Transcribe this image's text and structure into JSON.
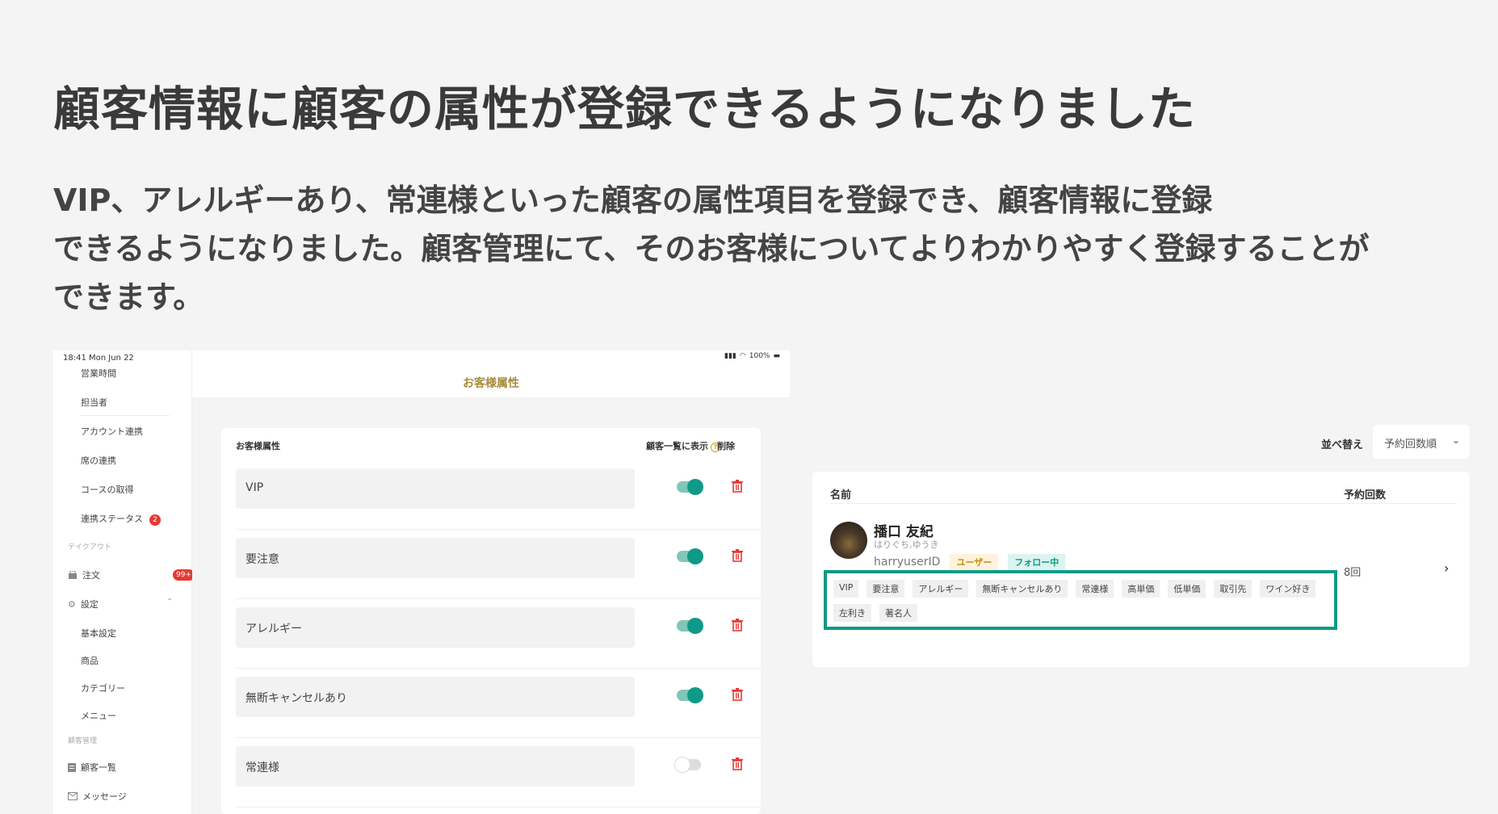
{
  "headline": "顧客情報に顧客の属性が登録できるようになりました",
  "description": [
    "VIP、アレルギーあり、常連様といった顧客の属性項目を登録でき、顧客情報に登録",
    "できるようになりました。顧客管理にて、そのお客様についてよりわかりやすく登録することが",
    "できます。"
  ],
  "ipad": {
    "status_time": "18:41 Mon Jun 22",
    "status_battery": "100%",
    "sidebar": {
      "items_top": [
        "営業時間",
        "担当者",
        "アカウント連携",
        "席の連携",
        "コースの取得"
      ],
      "link_status": "連携ステータス",
      "link_status_badge": "2",
      "section_takeout": "テイクアウト",
      "orders": "注文",
      "orders_badge": "99+",
      "settings": "設定",
      "settings_children": [
        "基本設定",
        "商品",
        "カテゴリー",
        "メニュー"
      ],
      "section_customers": "顧客管理",
      "customer_list": "顧客一覧",
      "messages": "メッセージ"
    },
    "page_title": "お客様属性",
    "table_headers": {
      "attribute": "お客様属性",
      "show_in_list": "顧客一覧に表示",
      "delete": "削除"
    },
    "attributes": [
      {
        "name": "VIP",
        "shown": true
      },
      {
        "name": "要注意",
        "shown": true
      },
      {
        "name": "アレルギー",
        "shown": true
      },
      {
        "name": "無断キャンセルあり",
        "shown": true
      },
      {
        "name": "常連様",
        "shown": false
      }
    ]
  },
  "customer_list": {
    "sort_label": "並べ替え",
    "sort_value": "予約回数順",
    "col_name": "名前",
    "col_count": "予約回数",
    "customer": {
      "name": "播口 友紀",
      "kana": "はりぐち,ゆうき",
      "user_id": "harryuserID",
      "tag_user": "ユーザー",
      "tag_follow": "フォロー中",
      "count": "8回",
      "attributes": [
        "VIP",
        "要注意",
        "アレルギー",
        "無断キャンセルあり",
        "常連様",
        "高単価",
        "低単価",
        "取引先",
        "ワイン好き",
        "左利き",
        "著名人"
      ]
    }
  },
  "colors": {
    "accent": "#0f9a87",
    "gold": "#a88a3c",
    "danger": "#e53935"
  }
}
